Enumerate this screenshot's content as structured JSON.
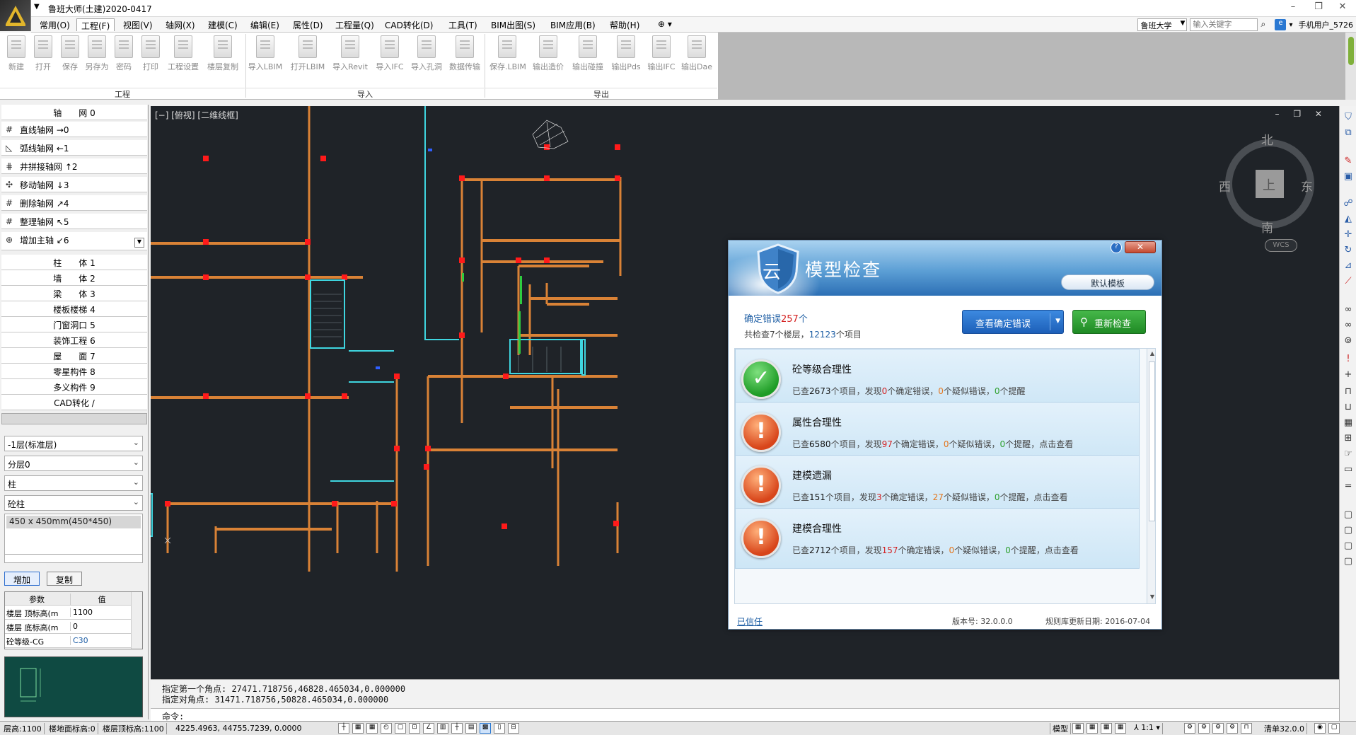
{
  "app": {
    "title": "鲁班大师(土建)2020-0417",
    "window_controls": [
      "–",
      "❐",
      "✕"
    ]
  },
  "menu": {
    "items": [
      "常用(O)",
      "工程(F)",
      "视图(V)",
      "轴网(X)",
      "建模(C)",
      "编辑(E)",
      "属性(D)",
      "工程量(Q)",
      "CAD转化(D)",
      "工具(T)",
      "BIM出图(S)",
      "BIM应用(B)",
      "帮助(H)",
      "⊕ ▾"
    ],
    "active_index": 1,
    "school": "鲁班大学",
    "search_placeholder": "输入关键字",
    "user": "手机用户_5726"
  },
  "ribbon": {
    "groups": [
      {
        "label": "工程",
        "buttons": [
          "新建",
          "打开",
          "保存",
          "另存为",
          "密码",
          "打印",
          "工程设置",
          "楼层复制"
        ]
      },
      {
        "label": "导入",
        "buttons": [
          "导入LBIM",
          "打开LBIM",
          "导入Revit",
          "导入IFC",
          "导入孔洞",
          "数据传输"
        ]
      },
      {
        "label": "导出",
        "buttons": [
          "保存.LBIM",
          "输出造价",
          "输出碰撞",
          "输出Pds",
          "输出IFC",
          "输出Dae"
        ]
      }
    ]
  },
  "left_panel": {
    "axis_header": "轴　　网 0",
    "axis_tools": [
      {
        "label": "直线轴网",
        "key": "→0"
      },
      {
        "label": "弧线轴网",
        "key": "←1"
      },
      {
        "label": "井拼接轴网",
        "key": "↑2"
      },
      {
        "label": "移动轴网",
        "key": "↓3"
      },
      {
        "label": "删除轴网",
        "key": "↗4"
      },
      {
        "label": "整理轴网",
        "key": "↖5"
      },
      {
        "label": "增加主轴",
        "key": "↙6"
      }
    ],
    "categories": [
      "柱　　体 1",
      "墙　　体 2",
      "梁　　体 3",
      "楼板楼梯 4",
      "门窗洞口 5",
      "装饰工程 6",
      "屋　　面 7",
      "零星构件 8",
      "多义构件 9",
      "CAD转化 /"
    ],
    "selects": [
      "-1层(标准层)",
      "分层0",
      "柱",
      "砼柱"
    ],
    "list_selected": "450 x 450mm(450*450)",
    "add_button": "增加",
    "copy_button": "复制",
    "param_headers": [
      "参数",
      "值"
    ],
    "params": [
      {
        "name": "楼层 顶标高(m",
        "value": "1100"
      },
      {
        "name": "楼层 底标高(m",
        "value": "0"
      },
      {
        "name": "砼等级-CG",
        "value": "C30"
      }
    ]
  },
  "canvas": {
    "view_label": "[−] [俯视] [二维线框]",
    "view_controls": "– ❐ ✕",
    "compass": {
      "n": "北",
      "s": "南",
      "e": "东",
      "w": "西",
      "top": "上"
    },
    "wcs": "WCS"
  },
  "command": {
    "line1": "指定第一个角点: 27471.718756,46828.465034,0.000000",
    "line2": "指定对角点: 31471.718756,50828.465034,0.000000",
    "prompt": "命令:"
  },
  "statusbar": {
    "cells": [
      "层高:1100",
      "楼地面标高:0",
      "楼层顶标高:1100"
    ],
    "coord": "4225.4963, 44755.7239, 0.0000",
    "right": [
      "模型",
      "⅄ 1:1 ▾",
      "清单32.0.0"
    ]
  },
  "dialog": {
    "title": "模型检查",
    "cloud_char": "云",
    "help": "?",
    "close": "✕",
    "default_template": "默认模板",
    "confirmed_errors_label": "确定错误",
    "confirmed_errors_count": "257",
    "confirmed_errors_unit": "个",
    "summary_prefix": "共检查7个楼层，",
    "summary_count": "12123",
    "summary_suffix": "个项目",
    "view_errors_button": "查看确定错误",
    "recheck_button": "重新检查",
    "items": [
      {
        "title": "砼等级合理性",
        "status": "ok",
        "checked": "2673",
        "confirmed": "0",
        "suspected": "0",
        "reminder": "0",
        "tail": ""
      },
      {
        "title": "属性合理性",
        "status": "warn",
        "checked": "6580",
        "confirmed": "97",
        "suspected": "0",
        "reminder": "0",
        "tail": "，点击查看"
      },
      {
        "title": "建模遗漏",
        "status": "warn",
        "checked": "151",
        "confirmed": "3",
        "suspected": "27",
        "reminder": "0",
        "tail": "，点击查看"
      },
      {
        "title": "建模合理性",
        "status": "warn",
        "checked": "2712",
        "confirmed": "157",
        "suspected": "0",
        "reminder": "0",
        "tail": "，点击查看"
      }
    ],
    "trusted_link": "已信任",
    "version": "版本号: 32.0.0.0",
    "rule_update": "规则库更新日期: 2016-07-04"
  },
  "colors": {
    "canvas_bg": "#1f2328",
    "wall": "#d98236",
    "column": "#ff1a1a",
    "stair": "#3fd6e0",
    "accent": "#1f5fa5"
  }
}
